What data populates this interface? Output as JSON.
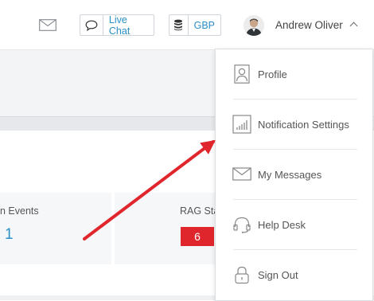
{
  "header": {
    "live_chat_label": "Live Chat",
    "currency_label": "GBP",
    "user_name": "Andrew Oliver",
    "icons": [
      "mail-icon",
      "chat-bubble-icon",
      "coins-icon",
      "avatar",
      "chevron-up-icon"
    ]
  },
  "dashboard": {
    "events_title": "n Events",
    "events_value": "1",
    "rag_title": "RAG Sta",
    "rag_value": "6",
    "colors": {
      "link": "#2a8fc4",
      "rag_red": "#e0262d",
      "arrow_red": "#e0262d"
    }
  },
  "user_menu": {
    "items": [
      {
        "label": "Profile",
        "icon": "profile-icon"
      },
      {
        "label": "Notification Settings",
        "icon": "signal-bars-icon"
      },
      {
        "label": "My Messages",
        "icon": "envelope-icon"
      },
      {
        "label": "Help Desk",
        "icon": "headset-icon"
      },
      {
        "label": "Sign Out",
        "icon": "padlock-icon"
      }
    ]
  }
}
